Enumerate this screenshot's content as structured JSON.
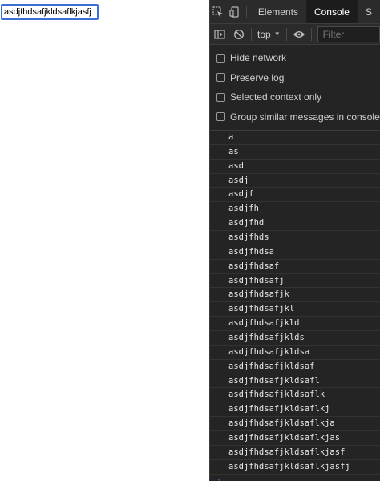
{
  "page": {
    "input_value": "asdjfhdsafjkldsaflkjasfj"
  },
  "devtools": {
    "tabs": [
      {
        "label": "Elements"
      },
      {
        "label": "Console"
      },
      {
        "label": "S"
      }
    ],
    "toolbar": {
      "context_label": "top",
      "filter_placeholder": "Filter"
    },
    "settings": [
      {
        "label": "Hide network",
        "checked": false
      },
      {
        "label": "Preserve log",
        "checked": false
      },
      {
        "label": "Selected context only",
        "checked": false
      },
      {
        "label": "Group similar messages in console",
        "checked": false
      }
    ],
    "messages": [
      "a",
      "as",
      "asd",
      "asdj",
      "asdjf",
      "asdjfh",
      "asdjfhd",
      "asdjfhds",
      "asdjfhdsa",
      "asdjfhdsaf",
      "asdjfhdsafj",
      "asdjfhdsafjk",
      "asdjfhdsafjkl",
      "asdjfhdsafjkld",
      "asdjfhdsafjklds",
      "asdjfhdsafjkldsa",
      "asdjfhdsafjkldsaf",
      "asdjfhdsafjkldsafl",
      "asdjfhdsafjkldsaflk",
      "asdjfhdsafjkldsaflkj",
      "asdjfhdsafjkldsaflkja",
      "asdjfhdsafjkldsaflkjas",
      "asdjfhdsafjkldsaflkjasf",
      "asdjfhdsafjkldsaflkjasfj"
    ],
    "prompt_glyph": "›"
  }
}
